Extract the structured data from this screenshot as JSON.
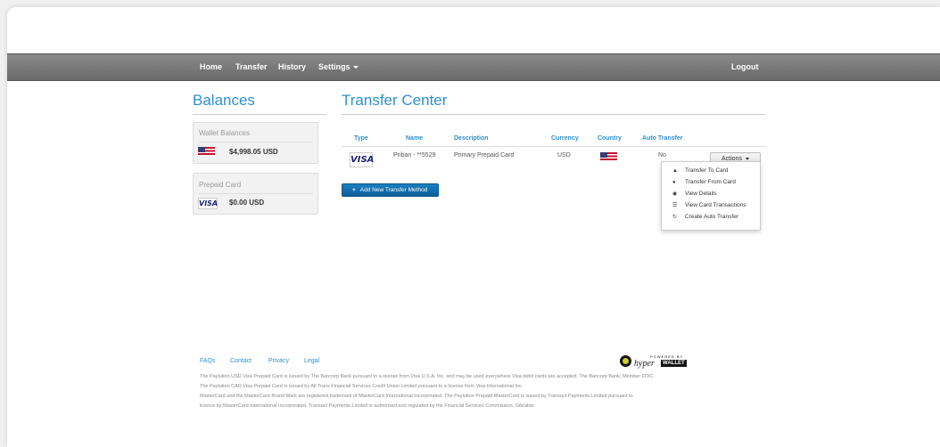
{
  "nav": {
    "home": "Home",
    "transfer": "Transfer",
    "history": "History",
    "settings": "Settings",
    "logout": "Logout"
  },
  "balances": {
    "title": "Balances",
    "wallet": {
      "title": "Wallet Balances",
      "amount": "$4,998.05 USD"
    },
    "prepaid": {
      "title": "Prepaid Card",
      "amount": "$0.00 USD"
    }
  },
  "transfer_center": {
    "title": "Transfer Center",
    "columns": [
      "Type",
      "Name",
      "Description",
      "Currency",
      "Country",
      "Auto Transfer"
    ],
    "row": {
      "type": "VISA",
      "name": "Priban - **5529",
      "description": "Primary Prepaid Card",
      "currency": "USD",
      "auto_transfer": "No"
    },
    "actions_label": "Actions",
    "menu": [
      {
        "icon": "upload-icon",
        "label": "Transfer To Card"
      },
      {
        "icon": "user-icon",
        "label": "Transfer From Card"
      },
      {
        "icon": "eye-icon",
        "label": "View Details"
      },
      {
        "icon": "list-icon",
        "label": "View Card Transactions"
      },
      {
        "icon": "refresh-icon",
        "label": "Create Auto Transfer"
      }
    ],
    "add_button": "Add New Transfer Method"
  },
  "footer": {
    "links": [
      "FAQs",
      "Contact",
      "Privacy",
      "Legal"
    ],
    "powered_by": "POWERED BY",
    "brand_hyper": "hyper",
    "brand_wallet": "WALLET",
    "legal_lines": [
      "The Paylution USD Visa Prepaid Card is issued by The Bancorp Bank pursuant to a license from Visa U.S.A. Inc. and may be used everywhere Visa debit cards are accepted. The Bancorp Bank; Member FDIC.",
      "The Paylution CAD Visa Prepaid Card is issued by All Trans Financial Services Credit Union Limited pursuant to a license from Visa International Inc.",
      "MasterCard and the MasterCard Brand Mark are registered trademark of MasterCard International Incorporated. The Paylution Prepaid MasterCard is issued by Transact Payments Limited pursuant to",
      "licence by MasterCard International Incorporated. Transact Payments Limited is authorised and regulated by the Financial Services Commission, Gibraltar"
    ]
  },
  "colors": {
    "accent": "#2e8fcc",
    "navbar": "#777777",
    "button_primary": "#1170b0"
  }
}
